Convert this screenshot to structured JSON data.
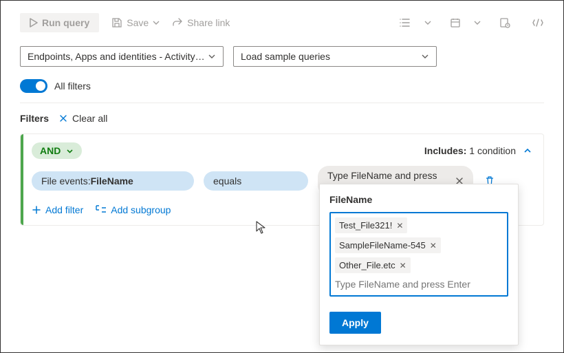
{
  "toolbar": {
    "run": "Run query",
    "save": "Save",
    "share": "Share link"
  },
  "dropdowns": {
    "scope": "Endpoints, Apps and identities - Activity…",
    "sample": "Load sample queries"
  },
  "toggle": {
    "label": "All filters"
  },
  "filters_header": {
    "label": "Filters",
    "clear": "Clear all"
  },
  "group": {
    "operator": "AND",
    "includes_label": "Includes:",
    "includes_count": "1 condition",
    "row": {
      "property_prefix": "File events: ",
      "property_name": "FileName",
      "op": "equals",
      "value_placeholder": "Type FileName and press …"
    },
    "add_filter": "Add filter",
    "add_subgroup": "Add subgroup"
  },
  "popover": {
    "title": "FileName",
    "chips": [
      "Test_File321!",
      "SampleFileName-545",
      "Other_File.etc"
    ],
    "placeholder": "Type FileName and press Enter",
    "apply": "Apply"
  }
}
